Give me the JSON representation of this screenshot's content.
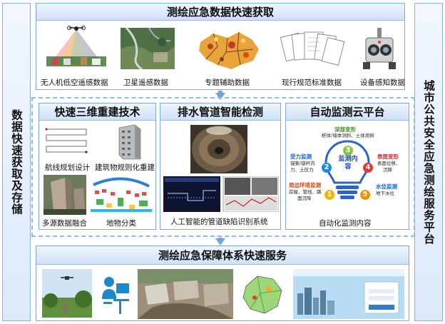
{
  "left_panel": {
    "label": "数据快速获取及存储"
  },
  "right_panel": {
    "label": "城市公共安全应急测绘服务平台"
  },
  "top_section": {
    "title": "测绘应急数据快速获取",
    "items": [
      {
        "label": "无人机低空遥感数据"
      },
      {
        "label": "卫星遥感数据"
      },
      {
        "label": "专题辅助数据"
      },
      {
        "label": "现行规范标准数据"
      },
      {
        "label": "设备感知数据"
      }
    ]
  },
  "recon_section": {
    "title": "快速三维重建技术",
    "items": [
      {
        "label": "航线规划设计"
      },
      {
        "label": "建筑物规则化重建"
      },
      {
        "label": "多源数据融合"
      },
      {
        "label": "地物分类"
      }
    ]
  },
  "pipe_section": {
    "title": "排水管道智能检测",
    "caption": "人工智能的管道缺陷识别系统"
  },
  "monitor_section": {
    "title": "自动监测云平台",
    "caption": "自动化监测内容",
    "center_label": "监测内容",
    "modules": [
      {
        "num": "1",
        "title": "周边环境监测",
        "text": [
          "房屋、管线、路",
          "面沉降"
        ]
      },
      {
        "num": "2",
        "title": "受力监测",
        "text": [
          "锚索/锚杆内",
          "力、土压力"
        ]
      },
      {
        "num": "3",
        "title": "深部变形",
        "text": [
          "桩体/墙体测斜、土体测斜"
        ]
      },
      {
        "num": "4",
        "title": "表面变形",
        "text": [
          "表面位移、",
          "沉降"
        ]
      },
      {
        "num": "5",
        "title": "水位监测",
        "text": [
          "地下水位"
        ]
      }
    ]
  },
  "bottom_section": {
    "title": "测绘应急保障体系快速服务"
  },
  "colors": {
    "accent": "#6fa4dc",
    "panel_border": "#8fb0dd"
  }
}
